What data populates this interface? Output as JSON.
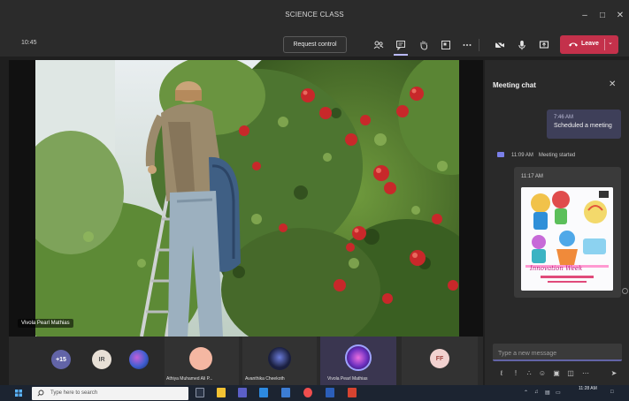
{
  "window": {
    "title": "SCIENCE CLASS"
  },
  "toolbar": {
    "timer": "10:45",
    "request_control_label": "Request control",
    "leave_label": "Leave"
  },
  "stage": {
    "presenter_name": "Vivola Pearl Mathias"
  },
  "chat": {
    "title": "Meeting chat",
    "my_message": {
      "time": "7:46 AM",
      "text": "Scheduled a meeting"
    },
    "system_message": {
      "time": "11:09 AM",
      "text": "Meeting started"
    },
    "image_message": {
      "time": "11:17 AM"
    },
    "compose_placeholder": "Type a new message"
  },
  "participants": {
    "overflow_count": "+15",
    "items": [
      {
        "initials": "IR",
        "name": ""
      },
      {
        "initials": "",
        "name": "Athiya Muhamed Ali P..."
      },
      {
        "initials": "",
        "name": "Avanthika Cheekoth"
      },
      {
        "initials": "",
        "name": "Vivola Pearl Mathias"
      },
      {
        "initials": "FF",
        "name": ""
      }
    ]
  },
  "taskbar": {
    "search_placeholder": "Type here to search",
    "clock_time": "11:28 AM"
  },
  "colors": {
    "leave": "#c4314b",
    "accent": "#6264a7",
    "chat_bubble": "#3e3f59"
  }
}
